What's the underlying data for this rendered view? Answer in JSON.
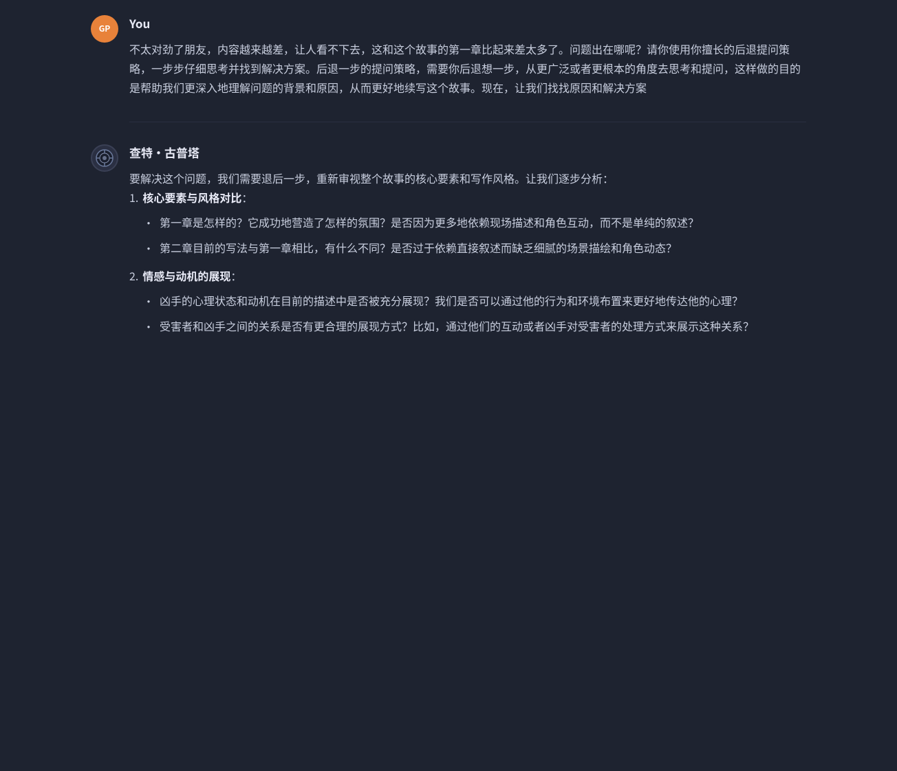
{
  "user": {
    "name": "You",
    "avatar_initials": "GP",
    "message": "不太对劲了朋友，内容越来越差，让人看不下去，这和这个故事的第一章比起来差太多了。问题出在哪呢？请你使用你擅长的后退提问策略，一步步仔细思考并找到解决方案。后退一步的提问策略，需要你后退想一步，从更广泛或者更根本的角度去思考和提问，这样做的目的是帮助我们更深入地理解问题的背景和原因，从而更好地续写这个故事。现在，让我们找找原因和解决方案"
  },
  "ai": {
    "name": "查特·古普塔",
    "intro": "要解决这个问题，我们需要退后一步，重新审视整个故事的核心要素和写作风格。让我们逐步分析：",
    "sections": [
      {
        "number": "1.",
        "title": "核心要素与风格对比",
        "colon": "：",
        "bullets": [
          "第一章是怎样的？它成功地营造了怎样的氛围？是否因为更多地依赖现场描述和角色互动，而不是单纯的叙述？",
          "第二章目前的写法与第一章相比，有什么不同？是否过于依赖直接叙述而缺乏细腻的场景描绘和角色动态？"
        ]
      },
      {
        "number": "2.",
        "title": "情感与动机的展现",
        "colon": "：",
        "bullets": [
          "凶手的心理状态和动机在目前的描述中是否被充分展现？我们是否可以通过他的行为和环境布置来更好地传达他的心理？",
          "受害者和凶手之间的关系是否有更合理的展现方式？比如，通过他们的互动或者凶手对受害者的处理方式来展示这种关系？"
        ]
      }
    ]
  }
}
